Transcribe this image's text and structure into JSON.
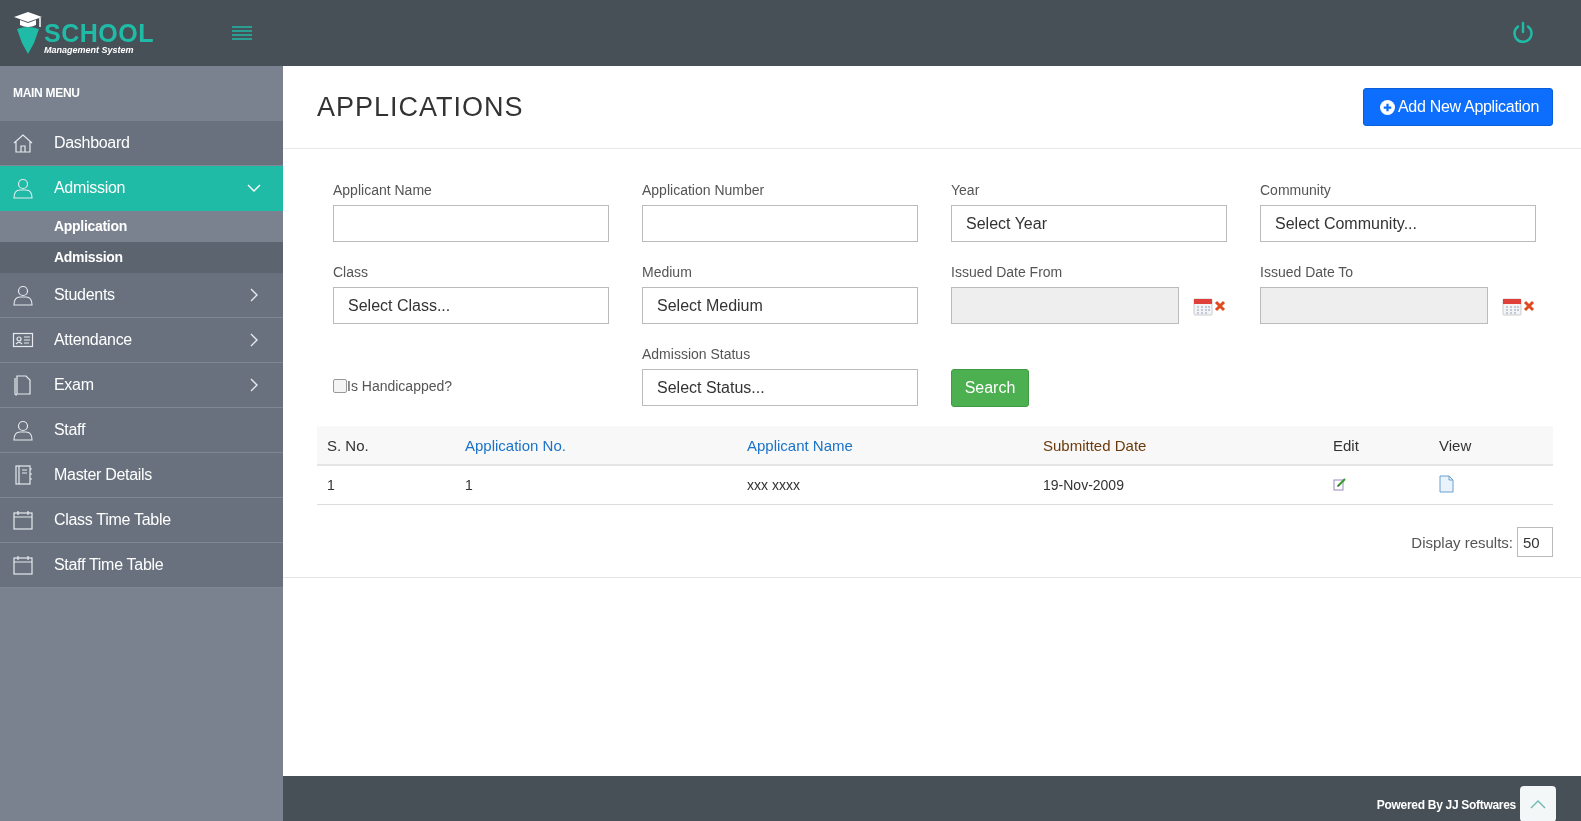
{
  "logo": {
    "title": "SCHOOL",
    "subtitle": "Management System"
  },
  "sidebar": {
    "heading": "MAIN MENU",
    "items": [
      {
        "label": "Dashboard",
        "kind": "link",
        "selected": false
      },
      {
        "label": "Admission",
        "kind": "group",
        "selected": true,
        "expanded": true,
        "children": [
          {
            "label": "Application",
            "selected": true
          },
          {
            "label": "Admission",
            "selected": false
          }
        ]
      },
      {
        "label": "Students",
        "kind": "group",
        "selected": false,
        "expanded": false
      },
      {
        "label": "Attendance",
        "kind": "group",
        "selected": false,
        "expanded": false
      },
      {
        "label": "Exam",
        "kind": "group",
        "selected": false,
        "expanded": false
      },
      {
        "label": "Staff",
        "kind": "link",
        "selected": false
      },
      {
        "label": "Master Details",
        "kind": "link",
        "selected": false
      },
      {
        "label": "Class Time Table",
        "kind": "link",
        "selected": false
      },
      {
        "label": "Staff Time Table",
        "kind": "link",
        "selected": false
      }
    ]
  },
  "page": {
    "title": "APPLICATIONS",
    "add_button": "Add New Application"
  },
  "filters": [
    {
      "kind": "text",
      "label": "Applicant Name"
    },
    {
      "kind": "text",
      "label": "Application Number"
    },
    {
      "kind": "select",
      "label": "Year",
      "value": "Select Year"
    },
    {
      "kind": "select",
      "label": "Community",
      "value": "Select Community..."
    },
    {
      "kind": "select",
      "label": "Class",
      "value": "Select Class..."
    },
    {
      "kind": "select",
      "label": "Medium",
      "value": "Select Medium"
    },
    {
      "kind": "date",
      "label": "Issued Date From",
      "disabled": true
    },
    {
      "kind": "date",
      "label": "Issued Date To",
      "disabled": true
    },
    {
      "kind": "checkbox",
      "label": "Is Handicapped?",
      "checked": false
    },
    {
      "kind": "select",
      "label": "Admission Status",
      "value": "Select Status..."
    },
    {
      "kind": "button",
      "label": "Search"
    }
  ],
  "table": {
    "columns": [
      {
        "label": "S. No.",
        "color": "#333333"
      },
      {
        "label": "Application No.",
        "color": "#1a73c8"
      },
      {
        "label": "Applicant Name",
        "color": "#1a73c8"
      },
      {
        "label": "Submitted Date",
        "color": "#6b3a0a"
      },
      {
        "label": "Edit",
        "color": "#333333"
      },
      {
        "label": "View",
        "color": "#333333"
      }
    ],
    "rows": [
      {
        "cells": [
          "1",
          "1",
          "xxx xxxx",
          "19-Nov-2009"
        ]
      }
    ]
  },
  "display_results": {
    "label": "Display results:",
    "value": "50"
  },
  "footer": {
    "text": "Powered By JJ Softwares"
  }
}
